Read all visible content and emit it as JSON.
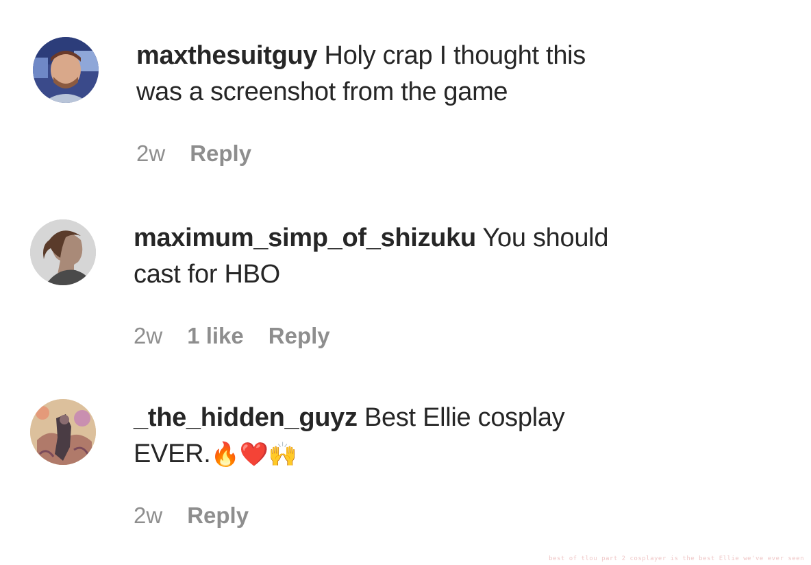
{
  "comments": [
    {
      "username": "maxthesuitguy",
      "text": "Holy crap I thought this was a screenshot from the game",
      "time": "2w",
      "likes": "",
      "reply_label": "Reply"
    },
    {
      "username": "maximum_simp_of_shizuku",
      "text": "You should cast for HBO",
      "time": "2w",
      "likes": "1 like",
      "reply_label": "Reply"
    },
    {
      "username": "_the_hidden_guyz",
      "text": "Best Ellie cosplay EVER.",
      "emojis": "🔥❤️🙌",
      "time": "2w",
      "likes": "",
      "reply_label": "Reply"
    }
  ],
  "watermark": "best of tlou part 2 cosplayer is the best Ellie we've ever seen"
}
